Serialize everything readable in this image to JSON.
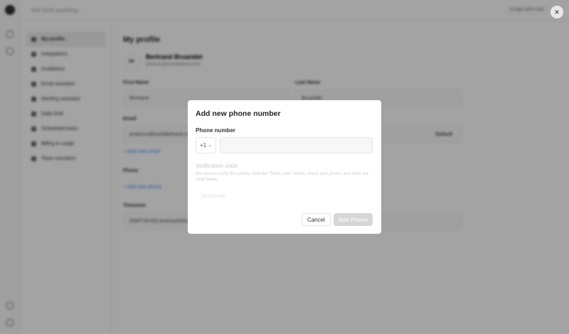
{
  "background": {
    "search_placeholder": "Ask Sunt anything...",
    "trial": "14 days left in trial",
    "sidebar": [
      "My profile",
      "Integrations",
      "Guidelines",
      "Email assistant",
      "Meeting assistant",
      "Daily brief",
      "Scheduled tasks",
      "Billing & usage",
      "Team members"
    ],
    "title": "My profile",
    "avatar": "BB",
    "user_name": "Bertrand Bruandet",
    "user_email": "products@invisiblehand.com",
    "first_name_label": "First Name",
    "first_name": "Bertrand",
    "last_name_label": "Last Name",
    "last_name": "Bruandet",
    "email_label": "Email",
    "email": "products@invisiblehand.com",
    "email_default": "Default",
    "add_email": "+ Add new email",
    "phone_label": "Phone",
    "add_phone": "+ Add new phone",
    "timezone_label": "Timezone",
    "timezone": "(GMT-04:00) America/New_York"
  },
  "dialog": {
    "title": "Add new phone number",
    "phone_label": "Phone number",
    "country_code": "+1",
    "phone_value": "",
    "verification_label": "Verification code",
    "verification_desc": "We need to verify this phone, click the \"Send code\" button, check your phone, and enter the code below.",
    "send_code": "Send code",
    "cancel": "Cancel",
    "add": "Add Phone"
  },
  "close_icon": "×"
}
